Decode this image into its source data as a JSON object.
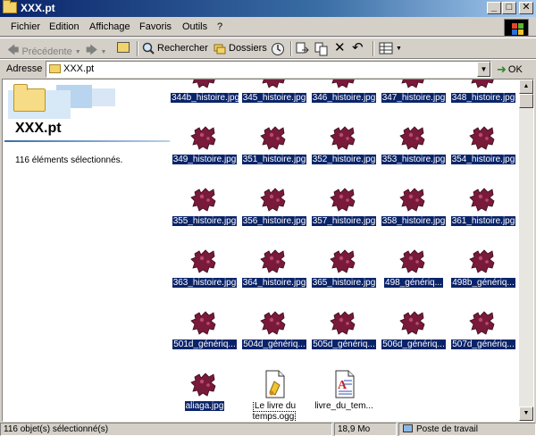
{
  "window": {
    "title": "XXX.pt",
    "minimize": "_",
    "maximize": "□",
    "close": "✕"
  },
  "menu": [
    "Fichier",
    "Edition",
    "Affichage",
    "Favoris",
    "Outils",
    "?"
  ],
  "toolbar": {
    "back": "Précédente",
    "search": "Rechercher",
    "folders": "Dossiers"
  },
  "address": {
    "label": "Adresse",
    "value": "XXX.pt",
    "go": "OK"
  },
  "sidebar": {
    "folder_name": "XXX.pt",
    "selection_text": "116 éléments sélectionnés."
  },
  "files": [
    {
      "name": "344b_histoire.jpg",
      "type": "image",
      "selected": true
    },
    {
      "name": "345_histoire.jpg",
      "type": "image",
      "selected": true
    },
    {
      "name": "346_histoire.jpg",
      "type": "image",
      "selected": true
    },
    {
      "name": "347_histoire.jpg",
      "type": "image",
      "selected": true
    },
    {
      "name": "348_histoire.jpg",
      "type": "image",
      "selected": true
    },
    {
      "name": "349_histoire.jpg",
      "type": "image",
      "selected": true
    },
    {
      "name": "351_histoire.jpg",
      "type": "image",
      "selected": true
    },
    {
      "name": "352_histoire.jpg",
      "type": "image",
      "selected": true
    },
    {
      "name": "353_histoire.jpg",
      "type": "image",
      "selected": true
    },
    {
      "name": "354_histoire.jpg",
      "type": "image",
      "selected": true
    },
    {
      "name": "355_histoire.jpg",
      "type": "image",
      "selected": true
    },
    {
      "name": "356_histoire.jpg",
      "type": "image",
      "selected": true
    },
    {
      "name": "357_histoire.jpg",
      "type": "image",
      "selected": true
    },
    {
      "name": "358_histoire.jpg",
      "type": "image",
      "selected": true
    },
    {
      "name": "361_histoire.jpg",
      "type": "image",
      "selected": true
    },
    {
      "name": "363_histoire.jpg",
      "type": "image",
      "selected": true
    },
    {
      "name": "364_histoire.jpg",
      "type": "image",
      "selected": true
    },
    {
      "name": "365_histoire.jpg",
      "type": "image",
      "selected": true
    },
    {
      "name": "498_génériq...",
      "type": "image",
      "selected": true
    },
    {
      "name": "498b_génériq...",
      "type": "image",
      "selected": true
    },
    {
      "name": "501d_génériq...",
      "type": "image",
      "selected": true
    },
    {
      "name": "504d_génériq...",
      "type": "image",
      "selected": true
    },
    {
      "name": "505d_génériq...",
      "type": "image",
      "selected": true
    },
    {
      "name": "506d_génériq...",
      "type": "image",
      "selected": true
    },
    {
      "name": "507d_génériq...",
      "type": "image",
      "selected": true
    },
    {
      "name": "aliaga.jpg",
      "type": "image",
      "selected": true
    },
    {
      "name": "Le livre du temps.ogg",
      "type": "audio",
      "selected": false
    },
    {
      "name": "livre_du_tem...",
      "type": "doc",
      "selected": false
    }
  ],
  "status": {
    "selected": "116 objet(s) sélectionné(s)",
    "size": "18,9 Mo",
    "location": "Poste de travail"
  },
  "colors": {
    "selection": "#0a246a",
    "thumbnail": "#7a1a3a",
    "titlebar": "#0a246a"
  }
}
